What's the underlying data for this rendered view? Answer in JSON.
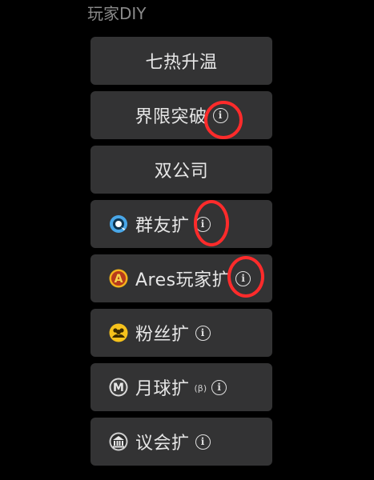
{
  "section": {
    "title": "玩家DIY"
  },
  "items": [
    {
      "label": "七热升温"
    },
    {
      "label": "界限突破"
    },
    {
      "label": "双公司"
    },
    {
      "label": "群友扩"
    },
    {
      "label": "Ares玩家扩"
    },
    {
      "label": "粉丝扩"
    },
    {
      "label": "月球扩",
      "badge": "(β)"
    },
    {
      "label": "议会扩"
    }
  ],
  "icons": {
    "info": "i",
    "group_friends": "qq-penguin-icon",
    "ares": "A",
    "fans": "fans-icon",
    "moon": "M",
    "council": "council-icon"
  },
  "colors": {
    "background": "#000000",
    "button": "#333334",
    "text": "#e6e6e6",
    "title": "#8a8a8a",
    "highlight": "#ff2b2b"
  }
}
